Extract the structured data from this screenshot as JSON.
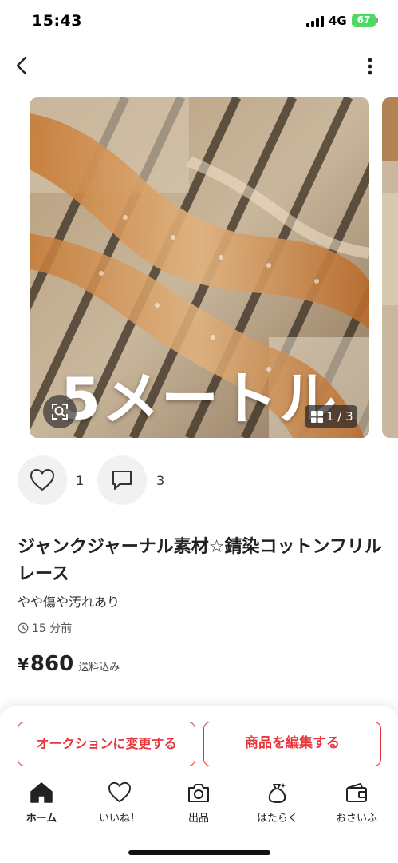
{
  "status_bar": {
    "time": "15:43",
    "network": "4G",
    "battery": "67"
  },
  "product": {
    "image_overlay_text": "5メートル",
    "page_indicator": "1 / 3",
    "likes": "1",
    "comments": "3",
    "title": "ジャンクジャーナル素材☆錆染コットンフリルレース",
    "condition": "やや傷や汚れあり",
    "posted": "15 分前",
    "currency": "¥",
    "price": "860",
    "shipping": "送料込み"
  },
  "actions": {
    "auction_label": "オークションに変更する",
    "edit_label": "商品を編集する"
  },
  "tabs": [
    {
      "label": "ホーム",
      "icon": "home-icon"
    },
    {
      "label": "いいね！",
      "icon": "heart-icon"
    },
    {
      "label": "出品",
      "icon": "camera-icon"
    },
    {
      "label": "はたらく",
      "icon": "money-bag-icon"
    },
    {
      "label": "おさいふ",
      "icon": "wallet-icon"
    }
  ],
  "colors": {
    "accent": "#e8383d",
    "battery": "#4cd964"
  }
}
